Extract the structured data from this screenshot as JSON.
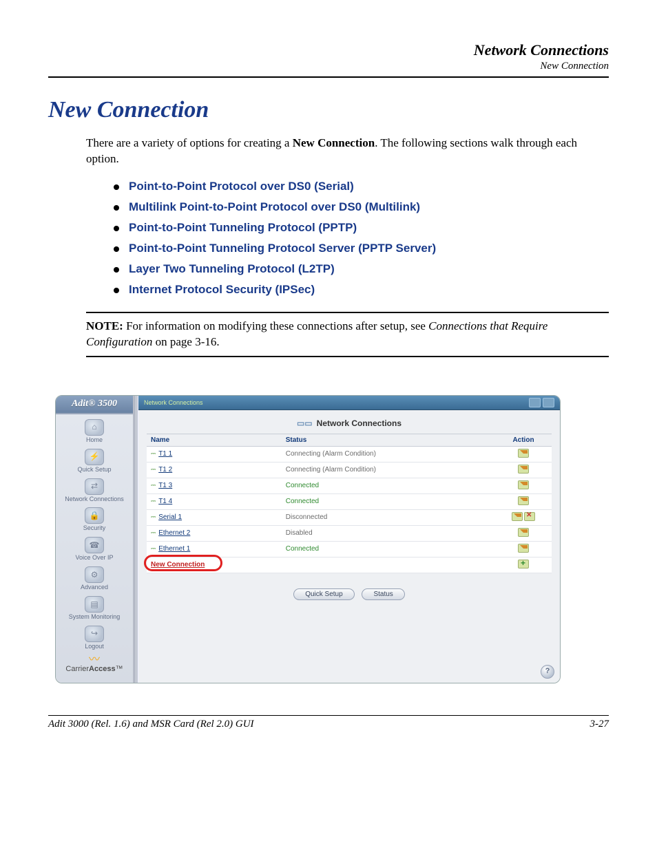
{
  "header": {
    "title": "Network Connections",
    "subtitle": "New Connection"
  },
  "h1": "New Connection",
  "intro_before": "There are a variety of options for creating a ",
  "intro_bold": "New Connection",
  "intro_after": ". The following sections walk through each option.",
  "options": [
    "Point-to-Point Protocol over DS0 (Serial)",
    "Multilink Point-to-Point Protocol over DS0 (Multilink)",
    "Point-to-Point Tunneling Protocol (PPTP)",
    "Point-to-Point Tunneling Protocol Server (PPTP Server)",
    "Layer Two Tunneling Protocol (L2TP)",
    "Internet Protocol Security (IPSec)"
  ],
  "note": {
    "label": "NOTE:",
    "before": "  For information on modifying these connections after setup, see ",
    "ital": "Connections that Require Configuration",
    "after": " on page 3-16."
  },
  "screenshot": {
    "product": "Adit® 3500",
    "brand1": "Carrier",
    "brand2": "Access",
    "brand_tm": "™",
    "sidebar": [
      {
        "label": "Home",
        "glyph": "⌂"
      },
      {
        "label": "Quick Setup",
        "glyph": "⚡"
      },
      {
        "label": "Network Connections",
        "glyph": "⇄"
      },
      {
        "label": "Security",
        "glyph": "🔒"
      },
      {
        "label": "Voice Over IP",
        "glyph": "☎"
      },
      {
        "label": "Advanced",
        "glyph": "⚙"
      },
      {
        "label": "System Monitoring",
        "glyph": "▤"
      },
      {
        "label": "Logout",
        "glyph": "↪"
      }
    ],
    "topbar_label": "Network Connections",
    "panel_title": "Network Connections",
    "columns": {
      "c1": "Name",
      "c2": "Status",
      "c3": "Action"
    },
    "rows": [
      {
        "name": "T1 1",
        "status": "Connecting (Alarm Condition)",
        "status_cls": "st-connecting",
        "actions": [
          "pencil"
        ]
      },
      {
        "name": "T1 2",
        "status": "Connecting (Alarm Condition)",
        "status_cls": "st-connecting",
        "actions": [
          "pencil"
        ]
      },
      {
        "name": "T1 3",
        "status": "Connected",
        "status_cls": "st-connected",
        "actions": [
          "pencil"
        ]
      },
      {
        "name": "T1 4",
        "status": "Connected",
        "status_cls": "st-connected",
        "actions": [
          "pencil"
        ]
      },
      {
        "name": "Serial 1",
        "status": "Disconnected",
        "status_cls": "st-disconnected",
        "actions": [
          "pencil",
          "del"
        ]
      },
      {
        "name": "Ethernet 2",
        "status": "Disabled",
        "status_cls": "st-disabled",
        "actions": [
          "pencil"
        ]
      },
      {
        "name": "Ethernet 1",
        "status": "Connected",
        "status_cls": "st-connected",
        "actions": [
          "pencil"
        ]
      }
    ],
    "new_connection_label": "New Connection",
    "buttons": {
      "b1": "Quick Setup",
      "b2": "Status"
    },
    "help_glyph": "?"
  },
  "footer": {
    "left": "Adit 3000 (Rel. 1.6) and MSR Card (Rel 2.0) GUI",
    "right": "3-27"
  }
}
